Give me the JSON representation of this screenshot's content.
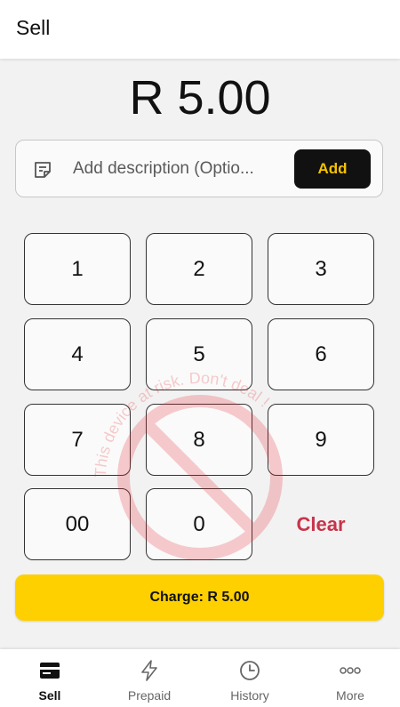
{
  "appbar": {
    "title": "Sell"
  },
  "amount": {
    "display": "R 5.00"
  },
  "description": {
    "placeholder": "Add description (Optio...",
    "value": "",
    "add_label": "Add"
  },
  "keypad": {
    "keys": [
      "1",
      "2",
      "3",
      "4",
      "5",
      "6",
      "7",
      "8",
      "9",
      "00",
      "0"
    ],
    "clear_label": "Clear"
  },
  "watermark": {
    "text": "This device at risk. Don't deal !"
  },
  "charge": {
    "label": "Charge: R 5.00"
  },
  "bottom_nav": {
    "items": [
      {
        "label": "Sell",
        "icon": "card-icon",
        "active": true
      },
      {
        "label": "Prepaid",
        "icon": "bolt-icon",
        "active": false
      },
      {
        "label": "History",
        "icon": "clock-icon",
        "active": false
      },
      {
        "label": "More",
        "icon": "more-icon",
        "active": false
      }
    ]
  },
  "colors": {
    "accent": "#ffd000",
    "add_text": "#f5c200",
    "clear": "#c7344a",
    "watermark": "#e8202a"
  }
}
